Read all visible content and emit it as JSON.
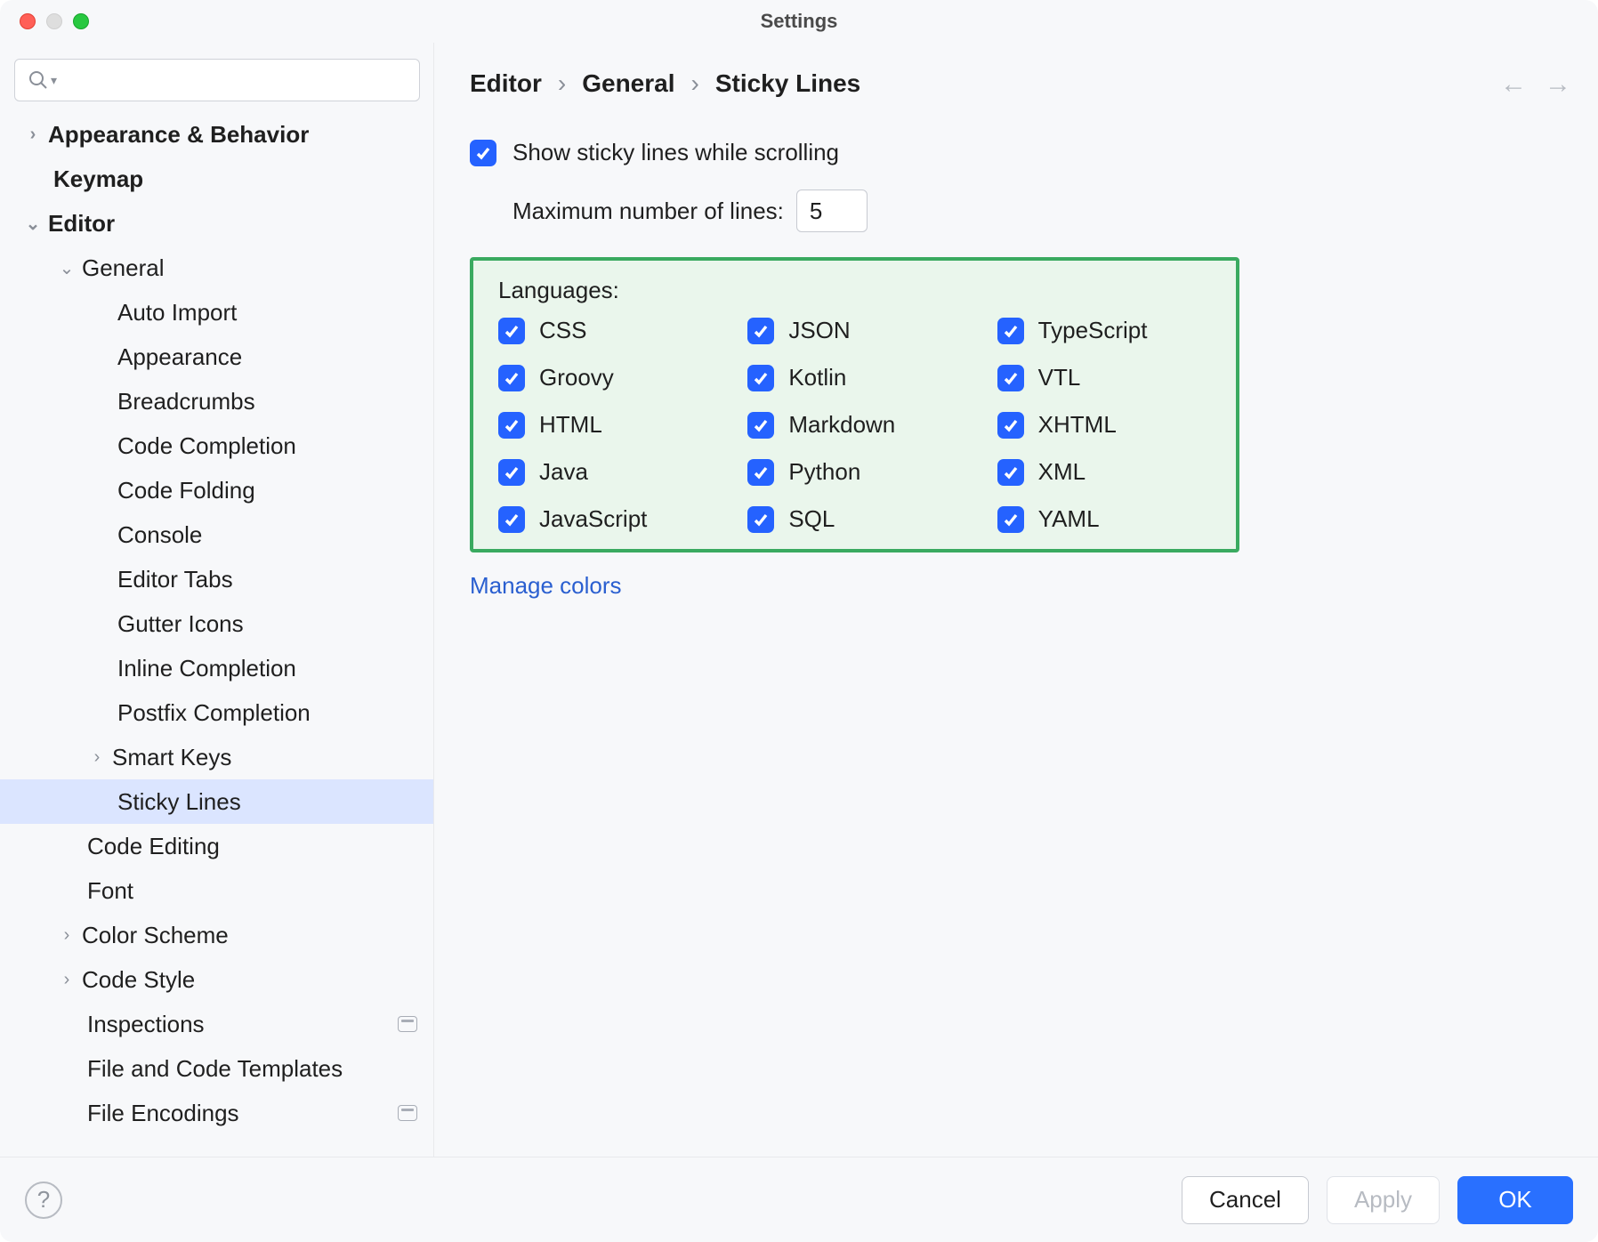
{
  "window": {
    "title": "Settings"
  },
  "search": {
    "placeholder": ""
  },
  "sidebar": {
    "items": [
      {
        "label": "Appearance & Behavior",
        "bold": true,
        "indent": 0,
        "chev": "right"
      },
      {
        "label": "Keymap",
        "bold": true,
        "indent": 0,
        "chev": ""
      },
      {
        "label": "Editor",
        "bold": true,
        "indent": 0,
        "chev": "down"
      },
      {
        "label": "General",
        "bold": false,
        "indent": 1,
        "chev": "down"
      },
      {
        "label": "Auto Import",
        "bold": false,
        "indent": 2,
        "chev": ""
      },
      {
        "label": "Appearance",
        "bold": false,
        "indent": 2,
        "chev": ""
      },
      {
        "label": "Breadcrumbs",
        "bold": false,
        "indent": 2,
        "chev": ""
      },
      {
        "label": "Code Completion",
        "bold": false,
        "indent": 2,
        "chev": ""
      },
      {
        "label": "Code Folding",
        "bold": false,
        "indent": 2,
        "chev": ""
      },
      {
        "label": "Console",
        "bold": false,
        "indent": 2,
        "chev": ""
      },
      {
        "label": "Editor Tabs",
        "bold": false,
        "indent": 2,
        "chev": ""
      },
      {
        "label": "Gutter Icons",
        "bold": false,
        "indent": 2,
        "chev": ""
      },
      {
        "label": "Inline Completion",
        "bold": false,
        "indent": 2,
        "chev": ""
      },
      {
        "label": "Postfix Completion",
        "bold": false,
        "indent": 2,
        "chev": ""
      },
      {
        "label": "Smart Keys",
        "bold": false,
        "indent": 2,
        "chev": "right"
      },
      {
        "label": "Sticky Lines",
        "bold": false,
        "indent": 2,
        "chev": "",
        "selected": true
      },
      {
        "label": "Code Editing",
        "bold": false,
        "indent": 1,
        "chev": ""
      },
      {
        "label": "Font",
        "bold": false,
        "indent": 1,
        "chev": ""
      },
      {
        "label": "Color Scheme",
        "bold": false,
        "indent": 1,
        "chev": "right"
      },
      {
        "label": "Code Style",
        "bold": false,
        "indent": 1,
        "chev": "right"
      },
      {
        "label": "Inspections",
        "bold": false,
        "indent": 1,
        "chev": "",
        "badge": true
      },
      {
        "label": "File and Code Templates",
        "bold": false,
        "indent": 1,
        "chev": ""
      },
      {
        "label": "File Encodings",
        "bold": false,
        "indent": 1,
        "chev": "",
        "badge": true
      }
    ]
  },
  "breadcrumb": {
    "a": "Editor",
    "b": "General",
    "c": "Sticky Lines",
    "sep": "›"
  },
  "settings": {
    "show_label": "Show sticky lines while scrolling",
    "max_label": "Maximum number of lines:",
    "max_value": "5",
    "languages_label": "Languages:",
    "langs": [
      "CSS",
      "JSON",
      "TypeScript",
      "Groovy",
      "Kotlin",
      "VTL",
      "HTML",
      "Markdown",
      "XHTML",
      "Java",
      "Python",
      "XML",
      "JavaScript",
      "SQL",
      "YAML"
    ],
    "manage_colors": "Manage colors"
  },
  "footer": {
    "cancel": "Cancel",
    "apply": "Apply",
    "ok": "OK"
  }
}
